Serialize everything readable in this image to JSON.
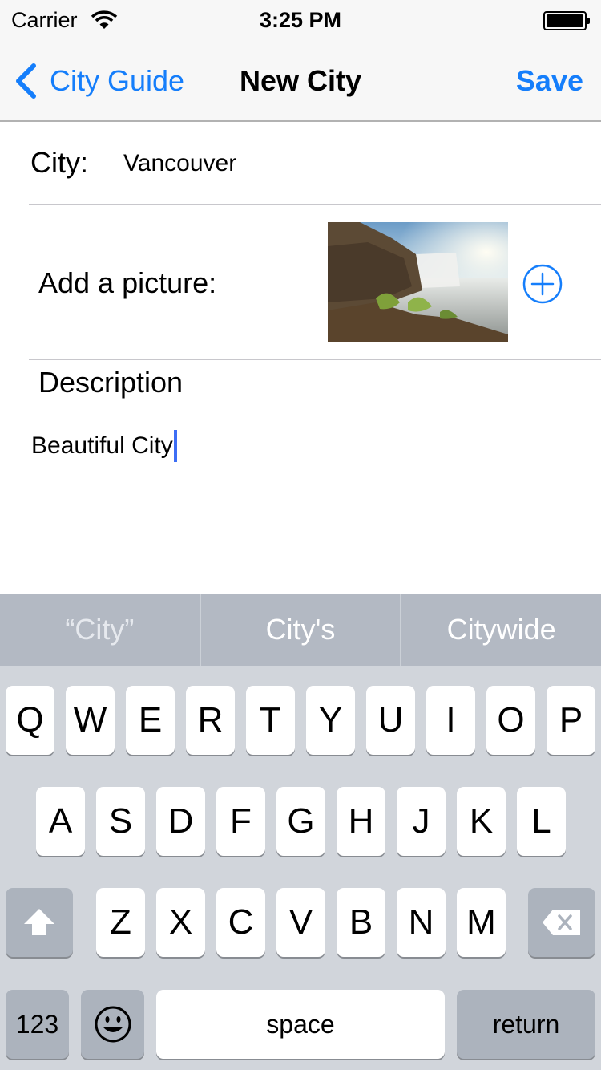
{
  "status_bar": {
    "carrier": "Carrier",
    "time": "3:25 PM"
  },
  "nav": {
    "back_label": "City Guide",
    "title": "New City",
    "save_label": "Save"
  },
  "form": {
    "city_label": "City:",
    "city_value": "Vancouver",
    "picture_label": "Add a picture:",
    "description_label": "Description",
    "description_value": "Beautiful City"
  },
  "keyboard": {
    "suggestions": [
      "“City”",
      "City's",
      "Citywide"
    ],
    "row1": [
      "Q",
      "W",
      "E",
      "R",
      "T",
      "Y",
      "U",
      "I",
      "O",
      "P"
    ],
    "row2": [
      "A",
      "S",
      "D",
      "F",
      "G",
      "H",
      "J",
      "K",
      "L"
    ],
    "row3": [
      "Z",
      "X",
      "C",
      "V",
      "B",
      "N",
      "M"
    ],
    "numbers_label": "123",
    "space_label": "space",
    "return_label": "return"
  },
  "colors": {
    "accent": "#157efb",
    "caret": "#3d6ef5",
    "keyboard_bg": "#d1d5db",
    "suggestion_bar": "#b3b9c3"
  },
  "icons": {
    "wifi": "wifi-icon",
    "battery": "battery-icon",
    "back": "chevron-left-icon",
    "add": "plus-circle-icon",
    "shift": "shift-arrow-icon",
    "delete": "backspace-icon",
    "emoji": "emoji-smiley-icon"
  }
}
